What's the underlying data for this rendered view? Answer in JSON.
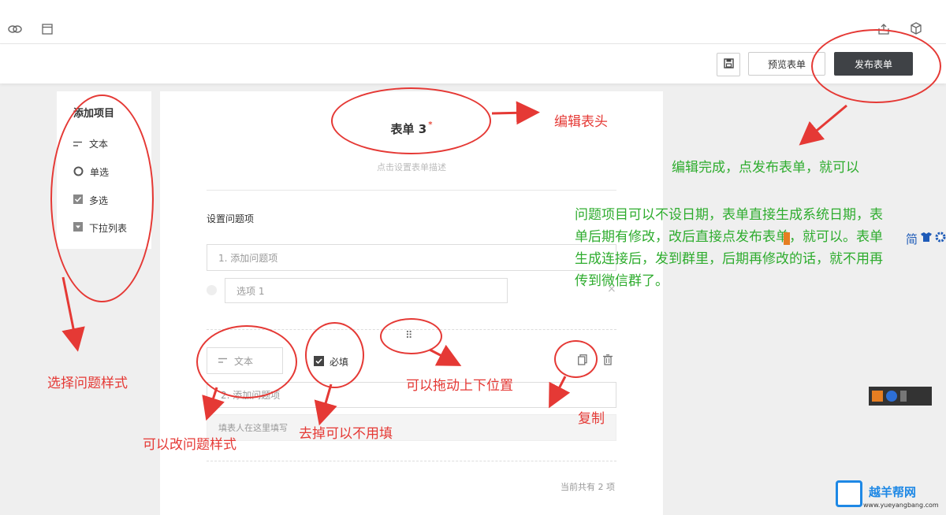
{
  "topbar": {
    "icons": [
      "link-icon",
      "window-icon",
      "share-icon",
      "cube-icon"
    ]
  },
  "toolbar": {
    "preview_label": "预览表单",
    "publish_label": "发布表单"
  },
  "sidebar": {
    "title": "添加项目",
    "items": [
      {
        "label": "文本",
        "icon": "text-icon"
      },
      {
        "label": "单选",
        "icon": "radio-icon"
      },
      {
        "label": "多选",
        "icon": "checkbox-icon"
      },
      {
        "label": "下拉列表",
        "icon": "dropdown-icon"
      }
    ]
  },
  "form": {
    "title": "表单 3",
    "title_required": "*",
    "description_placeholder": "点击设置表单描述",
    "section_label": "设置问题项",
    "q1": {
      "placeholder": "1. 添加问题项",
      "option1": "选项 1",
      "option_close": "×"
    },
    "q2": {
      "type_label": "文本",
      "required_label": "必填",
      "placeholder": "2. 添加问题项",
      "answer_placeholder": "填表人在这里填写"
    },
    "drag_handle": "⠿",
    "count_text": "当前共有 2 项"
  },
  "annotations": {
    "edit_header": "编辑表头",
    "publish_done": "编辑完成，点发布表单，就可以",
    "date_note": "问题项目可以不设日期，表单直接生成系统日期，表单后期有修改，改后直接点发布表单，就可以。表单生成连接后，发到群里，后期再修改的话，就不用再传到微信群了。",
    "choose_style": "选择问题样式",
    "change_style": "可以改问题样式",
    "remove_required": "去掉可以不用填",
    "drag_position": "可以拖动上下位置",
    "copy": "复制"
  },
  "toolbox": {
    "simplified_label": "简"
  },
  "watermark": {
    "site_name": "越羊帮网",
    "site_url": "www.yueyangbang.com"
  },
  "colors": {
    "annotation_red": "#e53935",
    "annotation_green": "#2eac2e",
    "publish_button": "#3f4246"
  }
}
